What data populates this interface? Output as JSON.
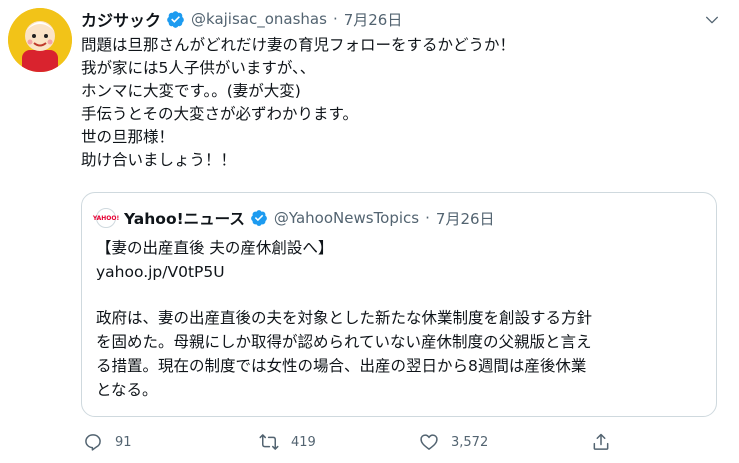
{
  "tweet": {
    "author": {
      "display_name": "カジサック",
      "handle": "@kajisac_onashas",
      "date": "7月26日",
      "separator": "·"
    },
    "text_lines": [
      "問題は旦那さんがどれだけ妻の育児フォローをするかどうか！",
      "我が家には5人子供がいますが、、",
      "ホンマに大変です。。(妻が大変)",
      "手伝うとその大変さが必ずわかります。",
      "世の旦那様！",
      "助け合いましょう！！"
    ],
    "quote": {
      "display_name": "Yahoo!ニュース",
      "handle": "@YahooNewsTopics",
      "date": "7月26日",
      "separator": "·",
      "logo_text": "YAHOO!",
      "headline": "【妻の出産直後 夫の産休創設へ】",
      "link": "yahoo.jp/V0tP5U",
      "body_lines": [
        "政府は、妻の出産直後の夫を対象とした新たな休業制度を創設する方針",
        "を固めた。母親にしか取得が認められていない産休制度の父親版と言え",
        "る措置。現在の制度では女性の場合、出産の翌日から8週間は産後休業",
        "となる。"
      ]
    },
    "actions": {
      "reply_count": "91",
      "retweet_count": "419",
      "like_count": "3,572"
    },
    "icons": {
      "verified": "verified-badge-icon",
      "reply": "reply-icon",
      "retweet": "retweet-icon",
      "like": "heart-icon",
      "share": "share-icon",
      "more": "chevron-down-icon"
    },
    "colors": {
      "verified": "#1d9bf0",
      "muted": "#536471",
      "border": "#cfd9de",
      "avatar_bg": "#f2c318",
      "yahoo_red": "#e60033"
    }
  }
}
